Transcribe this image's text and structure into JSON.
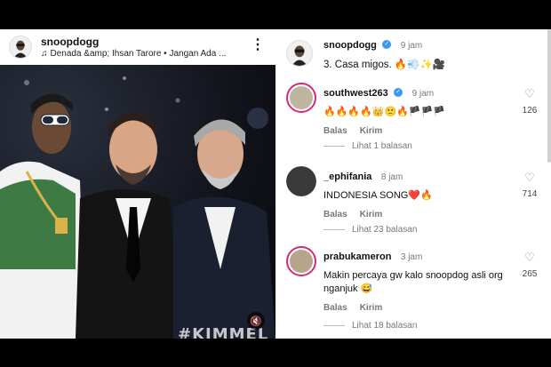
{
  "post": {
    "username": "snoopdogg",
    "audio": "Denada &amp; Ihsan Tarore • Jangan Ada ...",
    "watermark": "#KIMMEL"
  },
  "caption": {
    "username": "snoopdogg",
    "time": "9 jam",
    "text": "3. Casa migos. 🔥💨✨🎥"
  },
  "comments": [
    {
      "username": "southwest263",
      "verified": true,
      "time": "9 jam",
      "text": "🔥🔥🔥🔥👑🙂🔥🏴🏴🏴",
      "reply_label": "Balas",
      "send_label": "Kirim",
      "likes": "126",
      "replies": "Lihat 1 balasan"
    },
    {
      "username": "_ephifania",
      "verified": false,
      "time": "8 jam",
      "text": "INDONESIA SONG❤️🔥",
      "reply_label": "Balas",
      "send_label": "Kirim",
      "likes": "714",
      "replies": "Lihat 23 balasan"
    },
    {
      "username": "prabukameron",
      "verified": false,
      "time": "3 jam",
      "text": "Makin percaya gw kalo snoopdog asli org nganjuk 😅",
      "reply_label": "Balas",
      "send_label": "Kirim",
      "likes": "265",
      "replies": "Lihat 18 balasan"
    }
  ],
  "icons": {
    "music": "♫",
    "more": "⋮",
    "heart": "♡",
    "mute": "🔇",
    "verified": "✓"
  },
  "colors": {
    "verified_blue": "#3897f0",
    "story_ring": "#d62976"
  }
}
